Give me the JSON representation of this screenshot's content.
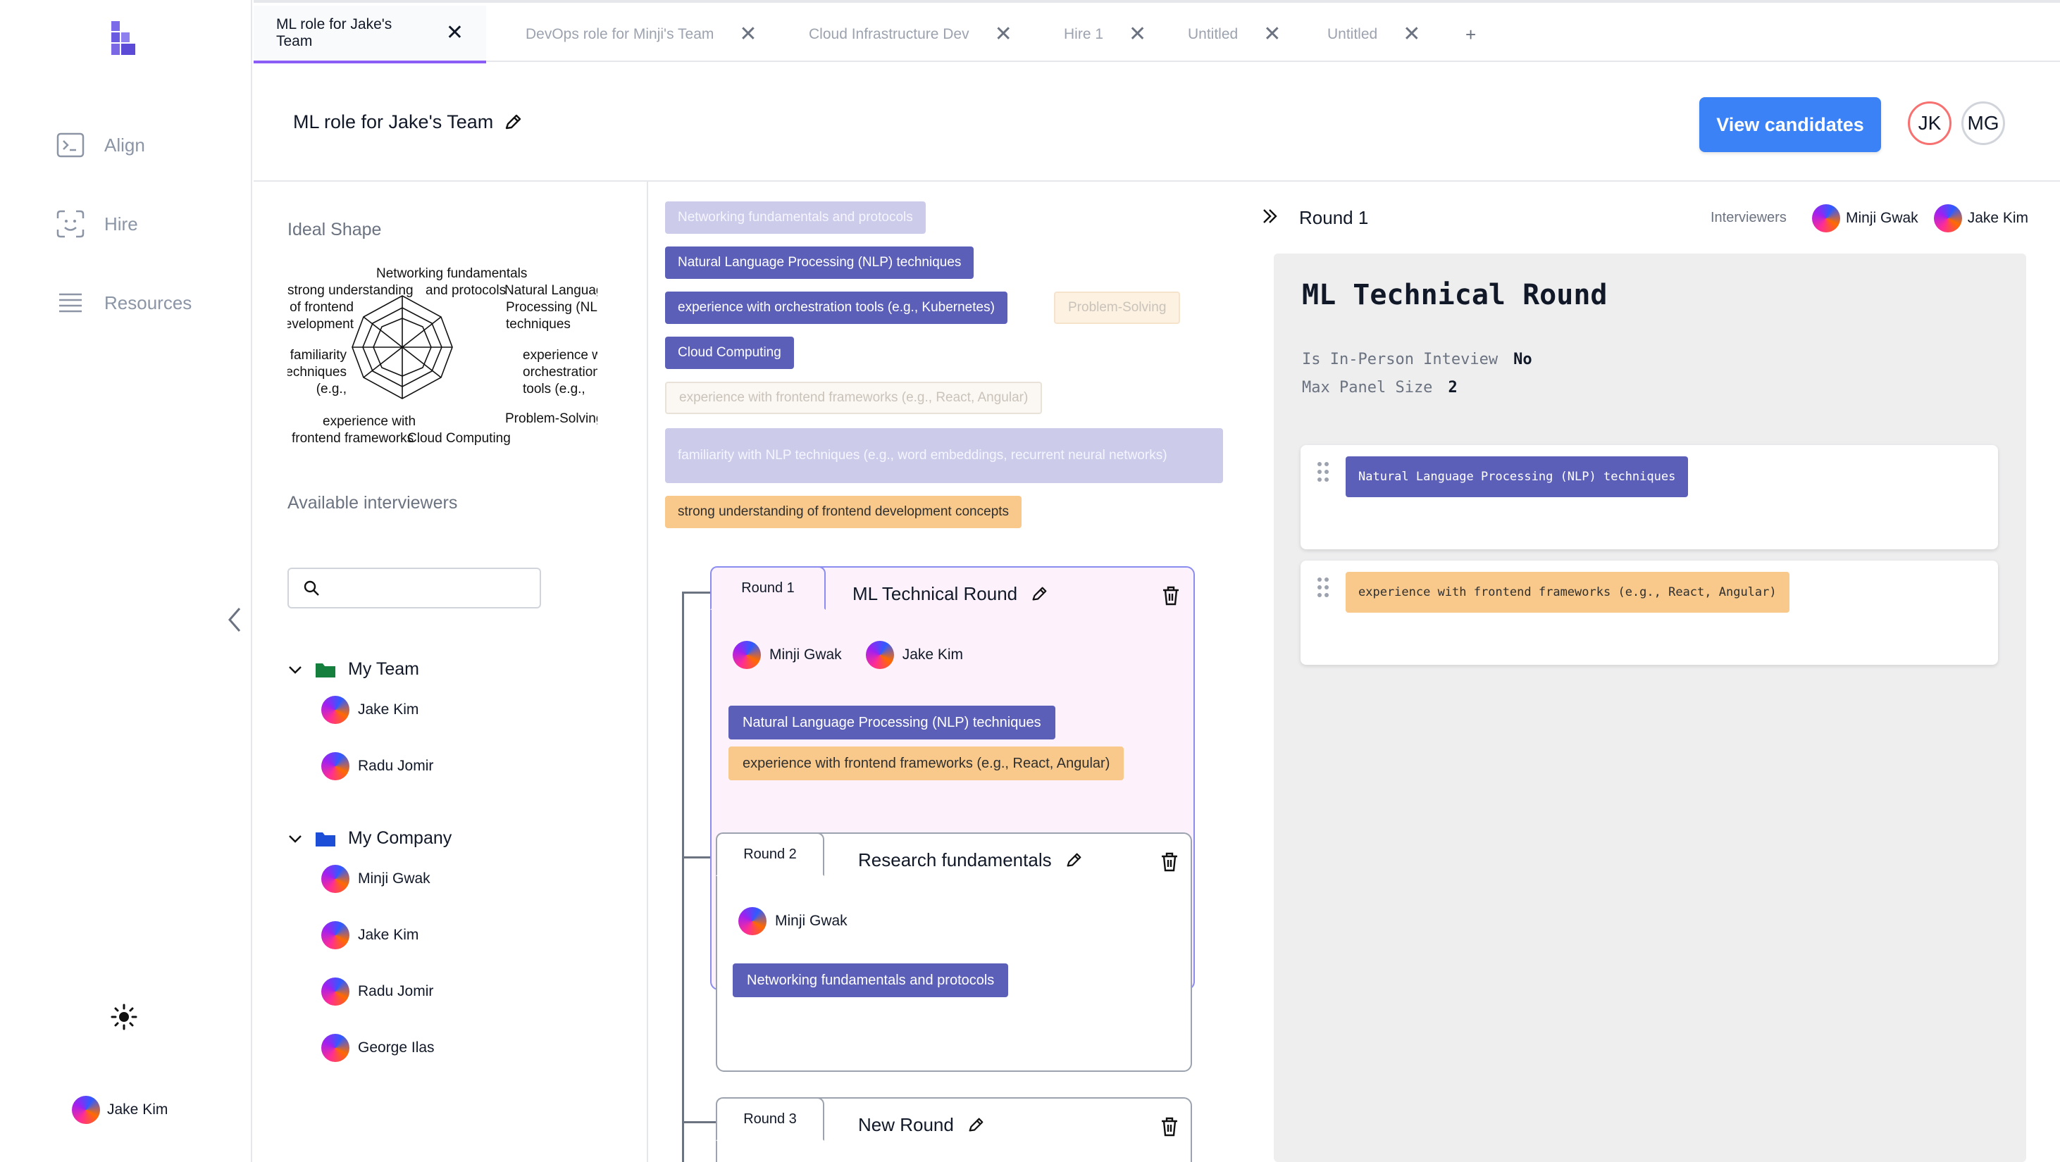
{
  "nav": {
    "items": [
      {
        "label": "Align",
        "icon": "terminal-icon"
      },
      {
        "label": "Hire",
        "icon": "scan-face-icon"
      },
      {
        "label": "Resources",
        "icon": "list-icon"
      }
    ],
    "theme_icon": "sun-icon",
    "current_user": "Jake Kim"
  },
  "tabs": [
    {
      "label": "ML role for Jake's Team",
      "active": true
    },
    {
      "label": "DevOps role for Minji's Team"
    },
    {
      "label": "Cloud Infrastructure Dev"
    },
    {
      "label": "Hire 1"
    },
    {
      "label": "Untitled"
    },
    {
      "label": "Untitled"
    }
  ],
  "tabs_add_label": "+",
  "header": {
    "title": "ML role for Jake's Team",
    "view_candidates": "View candidates",
    "users": [
      "JK",
      "MG"
    ],
    "user_colors": [
      "#f87171",
      "#d1d5db"
    ]
  },
  "left": {
    "ideal_shape_title": "Ideal Shape",
    "radar_labels": [
      "Networking fundamentals and protocols",
      "Natural Language Processing (NLP) techniques",
      "experience with orchestration tools (e.g.,",
      "Problem-Solving",
      "Cloud Computing",
      "experience with frontend frameworks (e.g.,",
      "familiarity with NLP techniques (e.g.,",
      "strong understanding of frontend development"
    ],
    "available_title": "Available interviewers",
    "search_placeholder": "",
    "groups": [
      {
        "name": "My Team",
        "folder_color": "#15803d",
        "members": [
          "Jake Kim",
          "Radu Jomir"
        ]
      },
      {
        "name": "My Company",
        "folder_color": "#1d4ed8",
        "members": [
          "Minji Gwak",
          "Jake Kim",
          "Radu Jomir",
          "George Ilas"
        ]
      }
    ]
  },
  "skills": [
    {
      "label": "Networking fundamentals and protocols",
      "style": "light"
    },
    {
      "label": "Natural Language Processing (NLP) techniques",
      "style": "dark"
    },
    {
      "label": "experience with orchestration tools (e.g., Kubernetes)",
      "style": "dark"
    },
    {
      "label": "Problem-Solving",
      "style": "peach-light"
    },
    {
      "label": "Cloud Computing",
      "style": "dark"
    },
    {
      "label": "experience with frontend frameworks (e.g., React, Angular)",
      "style": "ghost"
    },
    {
      "label": "familiarity with NLP techniques (e.g., word embeddings, recurrent neural networks)",
      "style": "light"
    },
    {
      "label": "strong understanding of frontend development concepts",
      "style": "peach"
    }
  ],
  "rounds": [
    {
      "tab": "Round 1",
      "title": "ML Technical Round",
      "interviewers": [
        "Minji Gwak",
        "Jake Kim"
      ],
      "skills": [
        "Natural Language Processing (NLP) techniques",
        "experience with frontend frameworks (e.g., React, Angular)"
      ]
    },
    {
      "tab": "Round 2",
      "title": "Research fundamentals",
      "interviewers": [
        "Minji Gwak"
      ],
      "skills": [
        "Networking fundamentals and protocols"
      ]
    },
    {
      "tab": "Round 3",
      "title": "New Round",
      "interviewers": [],
      "skills": []
    }
  ],
  "detail": {
    "round_label": "Round 1",
    "interviewers_label": "Interviewers",
    "interviewers": [
      "Minji Gwak",
      "Jake Kim"
    ],
    "title": "ML Technical Round",
    "in_person_label": "Is In-Person Inteview",
    "in_person_value": "No",
    "panel_size_label": "Max Panel Size",
    "panel_size_value": "2",
    "requirements": [
      {
        "label": "Natural Language Processing (NLP) techniques",
        "style": "dark"
      },
      {
        "label": "experience with frontend frameworks (e.g., React, Angular)",
        "style": "peach"
      }
    ]
  }
}
